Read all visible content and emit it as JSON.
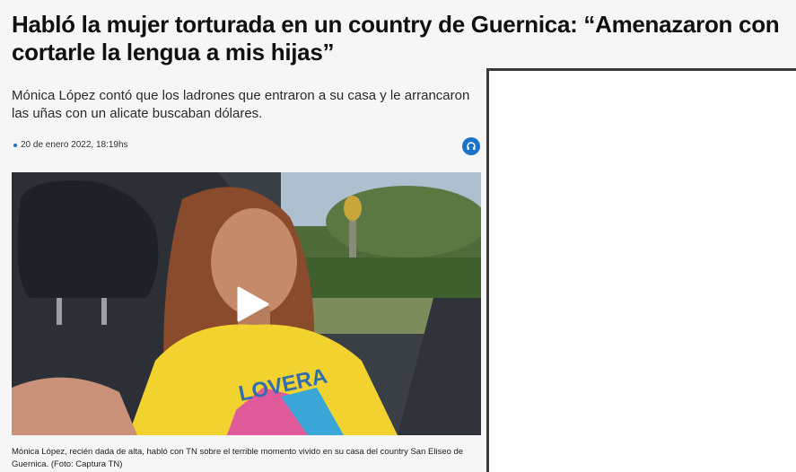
{
  "article": {
    "headline": "Habló la mujer torturada en un country de Guernica: “Amenazaron con cortarle la lengua a mis hijas”",
    "dek": "Mónica López contó que los ladrones que entraron a su casa y le arrancaron las uñas con un alicate buscaban dólares.",
    "date": "20 de enero 2022, 18:19hs",
    "caption": "Mónica López, recién dada de alta, habló con TN sobre el terrible momento vivido en su casa del country San Eliseo de Guernica. (Foto: Captura TN)"
  },
  "media": {
    "shirt_text": "LOVERA"
  },
  "icons": {
    "listen": "headphones-icon",
    "play": "play-icon"
  },
  "colors": {
    "accent": "#1a73c9",
    "shirt": "#f2d22e",
    "background": "#f6f6f6"
  }
}
